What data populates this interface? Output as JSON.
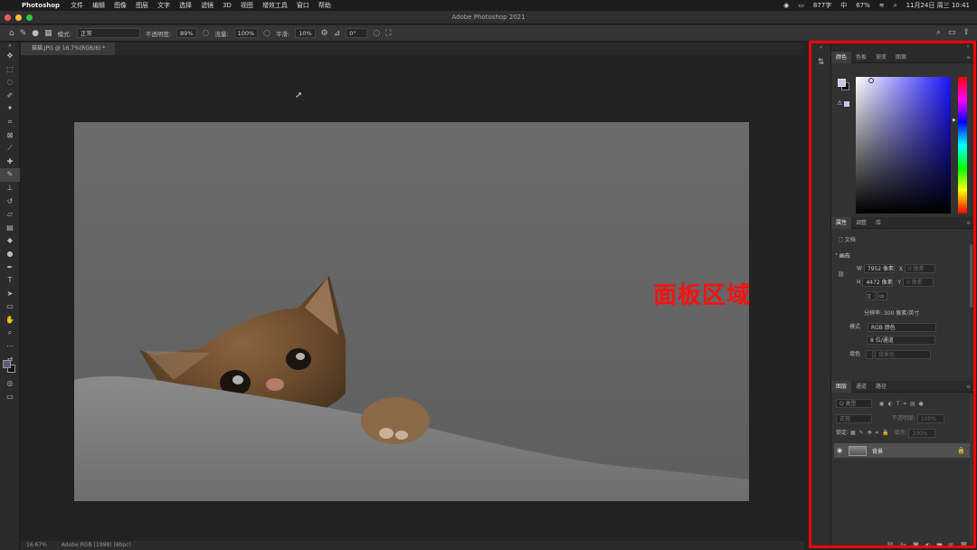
{
  "menubar": {
    "app": "Photoshop",
    "items": [
      "文件",
      "编辑",
      "图像",
      "图层",
      "文字",
      "选择",
      "滤镜",
      "3D",
      "视图",
      "增效工具",
      "窗口",
      "帮助"
    ],
    "right": {
      "count": "877字",
      "battery": "67%",
      "datetime": "11月24日 周三 10:41"
    }
  },
  "titlebar": {
    "title": "Adobe Photoshop 2021"
  },
  "options": {
    "mode_label": "模式:",
    "mode_value": "正常",
    "opacity_label": "不透明度:",
    "opacity_value": "89%",
    "flow_label": "流量:",
    "flow_value": "100%",
    "smooth_label": "平滑:",
    "smooth_value": "10%",
    "angle_value": "0°"
  },
  "document": {
    "tab": "猫猫.JPG @ 16.7%(RGB/8) *",
    "zoom": "16.67%",
    "profile": "Adobe RGB (1998) (8bpc)"
  },
  "color_panel": {
    "tabs": [
      "颜色",
      "色板",
      "渐变",
      "图案"
    ],
    "fg_color": "#c9c7e6",
    "bg_color": "#111111",
    "hue_color": "#1a14ff"
  },
  "props_panel": {
    "tabs": [
      "属性",
      "调整",
      "库"
    ],
    "doc_label": "文档",
    "canvas_label": "画布",
    "w_label": "W",
    "w_value": "7952 像素",
    "h_label": "H",
    "h_value": "4472 像素",
    "x_label": "X",
    "x_value": "0 像素",
    "y_label": "Y",
    "y_value": "0 像素",
    "resolution": "分辨率: 300 像素/英寸",
    "mode_label": "模式",
    "mode_value": "RGB 颜色",
    "depth_value": "8 位/通道",
    "fill_label": "填色",
    "fill_value": "背景色"
  },
  "layers_panel": {
    "tabs": [
      "图层",
      "通道",
      "路径"
    ],
    "filter_label": "Q 类型",
    "blend_value": "正常",
    "opacity_label": "不透明度:",
    "opacity_value": "100%",
    "lock_label": "锁定:",
    "fill_label": "填充:",
    "fill_value": "100%",
    "layer_name": "背景"
  },
  "annotation": "面板区域"
}
